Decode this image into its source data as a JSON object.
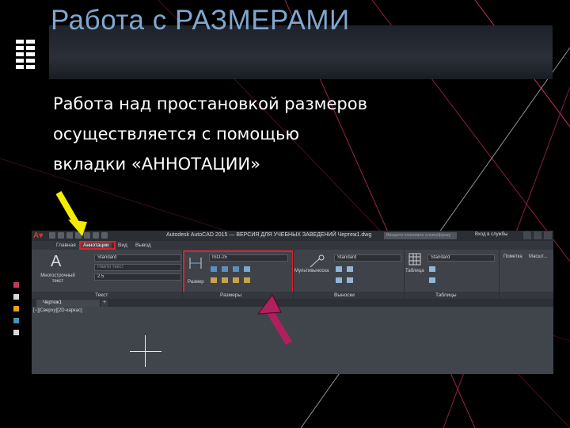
{
  "slide": {
    "title": "Работа  с  РАЗМЕРАМИ",
    "body_lines": [
      "Работа над простановкой размеров",
      "осуществляется с помощью",
      "вкладки «АННОТАЦИИ»"
    ]
  },
  "colors": {
    "title": "#7fa7cf",
    "highlight_box": "#e0202a",
    "yellow_arrow": "#f4ec00",
    "magenta_arrow": "#b0205f"
  },
  "autocad": {
    "window_title": "Autodesk AutoCAD 2015 — ВЕРСИЯ ДЛЯ УЧЕБНЫХ ЗАВЕДЕНИЙ   Чертеж1.dwg",
    "search_placeholder": "Введите ключевое слово/фразу",
    "signin": "Вход в службы",
    "ribbon_tabs": [
      "Главная",
      "Аннотации",
      "Вид",
      "Вывод"
    ],
    "active_tab": "Аннотации",
    "text_panel": {
      "big_button": "Многострочный текст",
      "style": "Standard",
      "font": "Найти текст",
      "height": "2.5",
      "footer": "Текст"
    },
    "dimensions_panel": {
      "button": "Размер",
      "style": "ISO-25",
      "footer": "Размеры"
    },
    "leaders_panel": {
      "button": "Мультивыноска",
      "style": "Standard",
      "footer": "Выноски"
    },
    "tables_panel": {
      "button": "Таблица",
      "style": "Standard",
      "footer": "Таблицы"
    },
    "extra_panels": [
      "Пометка",
      "Масшт..."
    ],
    "document_tab": "Чертеж1",
    "viewport_label": "[−][Сверху][2D-каркас]"
  }
}
